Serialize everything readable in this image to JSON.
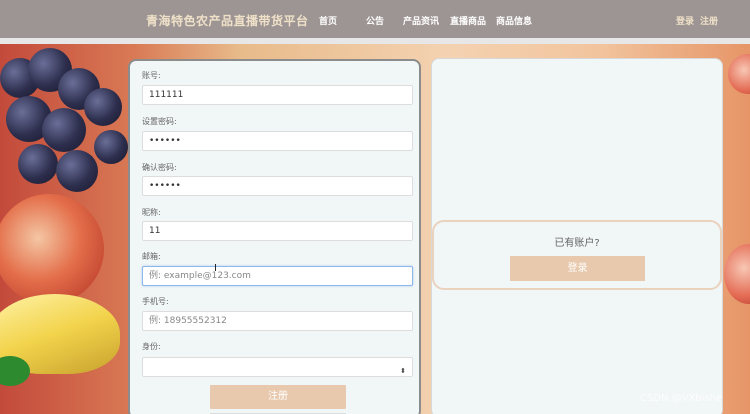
{
  "header": {
    "brand": "青海特色农产品直播带货平台",
    "nav": [
      "首页",
      "公告",
      "产品资讯",
      "直播商品",
      "商品信息"
    ],
    "login": "登录",
    "register": "注册"
  },
  "form": {
    "fields": [
      {
        "label": "账号:",
        "value": "111111",
        "placeholder": ""
      },
      {
        "label": "设置密码:",
        "value": "••••••",
        "placeholder": ""
      },
      {
        "label": "确认密码:",
        "value": "••••••",
        "placeholder": ""
      },
      {
        "label": "昵称:",
        "value": "11",
        "placeholder": ""
      },
      {
        "label": "邮箱:",
        "value": "",
        "placeholder": "例: example@123.com"
      },
      {
        "label": "手机号:",
        "value": "",
        "placeholder": "例: 18955552312"
      },
      {
        "label": "身份:",
        "value": "",
        "placeholder": ""
      }
    ],
    "submit_label": "注册"
  },
  "side": {
    "have_account": "已有账户?",
    "login_label": "登录"
  },
  "watermark": "CSDN @VXbishe",
  "colors": {
    "nav_bg": "#9d9593",
    "button": "#e8c9ad",
    "panel_bg": "#f1f6f6",
    "focus_border": "#8bb8e8"
  },
  "icons": {
    "select_arrow": "chevron-up-down-icon"
  }
}
